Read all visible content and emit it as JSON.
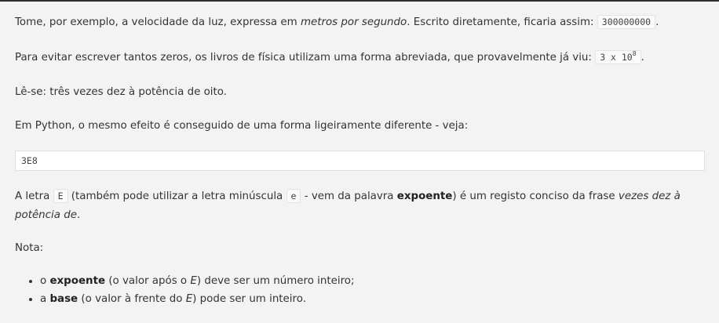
{
  "paragraphs": {
    "p1_a": "Tome, por exemplo, a velocidade da luz, expressa em ",
    "p1_em": "metros por segundo",
    "p1_b": ". Escrito diretamente, ficaria assim: ",
    "p1_code": "300000000",
    "p1_c": ".",
    "p2_a": "Para evitar escrever tantos zeros, os livros de física utilizam uma forma abreviada, que provavelmente já viu: ",
    "p2_code_base": "3 x 10",
    "p2_code_sup": "8",
    "p2_c": ".",
    "p3": "Lê-se: três vezes dez à potência de oito.",
    "p4": "Em Python, o mesmo efeito é conseguido de uma forma ligeiramente diferente - veja:",
    "code_block": "3E8",
    "p5_a": "A letra ",
    "p5_code1": "E",
    "p5_b": " (também pode utilizar a letra minúscula ",
    "p5_code2": "e",
    "p5_c": " - vem da palavra ",
    "p5_strong": "expoente",
    "p5_d": ") é um registo conciso da frase ",
    "p5_em": "vezes dez à potência de",
    "p5_e": ".",
    "p6": "Nota:"
  },
  "list": [
    {
      "a": "o ",
      "strong": "expoente",
      "b": " (o valor após o ",
      "em": "E",
      "c": ") deve ser um número inteiro;"
    },
    {
      "a": "a ",
      "strong": "base",
      "b": " (o valor à frente do ",
      "em": "E",
      "c": ") pode ser um inteiro."
    }
  ]
}
